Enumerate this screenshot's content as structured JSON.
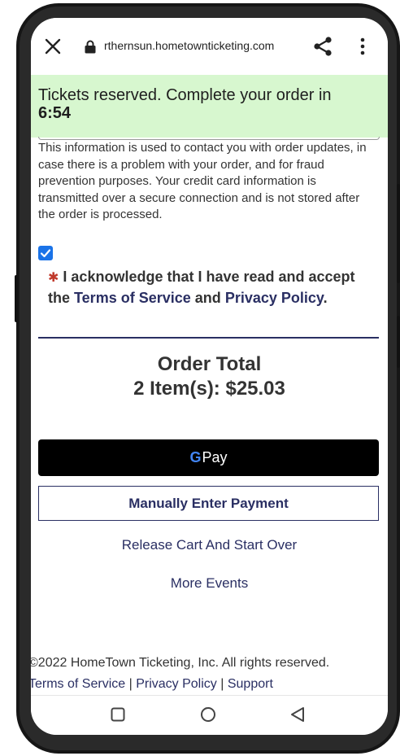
{
  "browser": {
    "url": "rthernsun.hometownticketing.com"
  },
  "banner": {
    "text": "Tickets reserved. Complete your order in",
    "time": "6:54"
  },
  "info_text": "This information is used to contact you with order updates, in case there is a problem with your order, and for fraud prevention purposes. Your credit card information is transmitted over a secure connection and is not stored after the order is processed.",
  "acknowledge": {
    "checked": true,
    "asterisk": "✱",
    "prefix": "I acknowledge that I have read and accept the",
    "terms_link": "Terms of Service",
    "and": "and",
    "privacy_link": "Privacy Policy",
    "period": "."
  },
  "order": {
    "title": "Order Total",
    "total": "2 Item(s): $25.03"
  },
  "buttons": {
    "gpay_g": "G",
    "gpay_label": "Pay",
    "manual": "Manually Enter Payment",
    "release": "Release Cart And Start Over",
    "more_events": "More Events"
  },
  "footer": {
    "copyright": "©2022 HomeTown Ticketing, Inc. All rights reserved.",
    "terms": "Terms of Service",
    "privacy": "Privacy Policy",
    "support": "Support",
    "separator": "|"
  },
  "colors": {
    "banner_bg": "#d7f7cf",
    "navy": "#2a2f63",
    "checkbox": "#1a73e8",
    "required": "#c0392b"
  },
  "icons": [
    "close-icon",
    "lock-icon",
    "share-icon",
    "more-vert-icon",
    "check-icon",
    "back-icon",
    "home-icon",
    "recent-apps-icon"
  ]
}
